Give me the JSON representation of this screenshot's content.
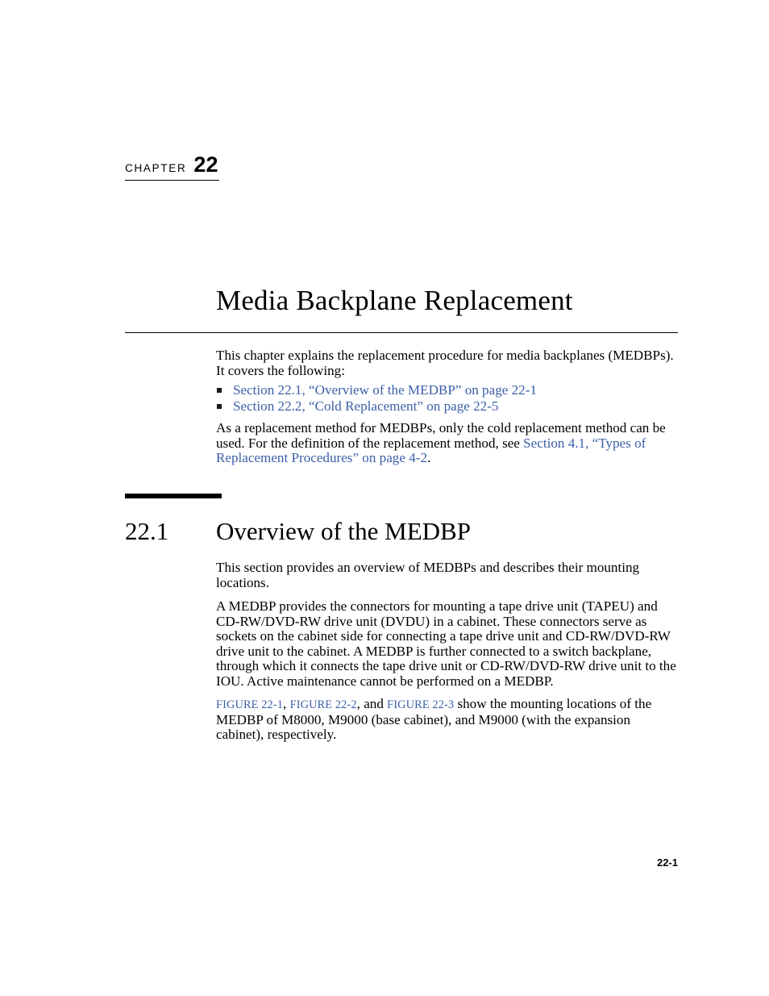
{
  "page": {
    "chapter_label_word": "CHAPTER",
    "chapter_number": "22",
    "chapter_title": "Media Backplane Replacement",
    "footer_page_number": "22-1"
  },
  "link_color": "#3a5fa8",
  "intro": {
    "lead_paragraph": "This chapter explains the replacement procedure for media backplanes (MEDBPs). It covers the following:",
    "bullets": [
      {
        "text": "Section 22.1, “Overview of the MEDBP” on page 22-1"
      },
      {
        "text": "Section 22.2, “Cold Replacement” on page 22-5"
      }
    ],
    "replacement_method": {
      "before_link": "As a replacement method for MEDBPs, only the cold replacement method can be used. For the definition of the replacement method, see ",
      "link_text": "Section 4.1, “Types of Replacement Procedures” on page 4-2",
      "after_link": "."
    }
  },
  "section": {
    "number": "22.1",
    "title": "Overview of the MEDBP",
    "intro_paragraph": "This section provides an overview of MEDBPs and describes their mounting locations.",
    "description_paragraph": "A MEDBP provides the connectors for mounting a tape drive unit (TAPEU) and CD-RW/DVD-RW drive unit (DVDU) in a cabinet. These connectors serve as sockets on the cabinet side for connecting a tape drive unit and CD-RW/DVD-RW drive unit to the cabinet. A MEDBP is further connected to a switch backplane, through which it connects the tape drive unit or CD-RW/DVD-RW drive unit to the IOU. Active maintenance cannot be performed on a MEDBP.",
    "figure_paragraph": {
      "fig1": "FIGURE 22-1",
      "sep1": ", ",
      "fig2": "FIGURE 22-2",
      "sep2": ", and ",
      "fig3": "FIGURE 22-3",
      "tail": " show the mounting locations of the MEDBP of M8000, M9000 (base cabinet), and M9000 (with the expansion cabinet), respectively."
    }
  }
}
